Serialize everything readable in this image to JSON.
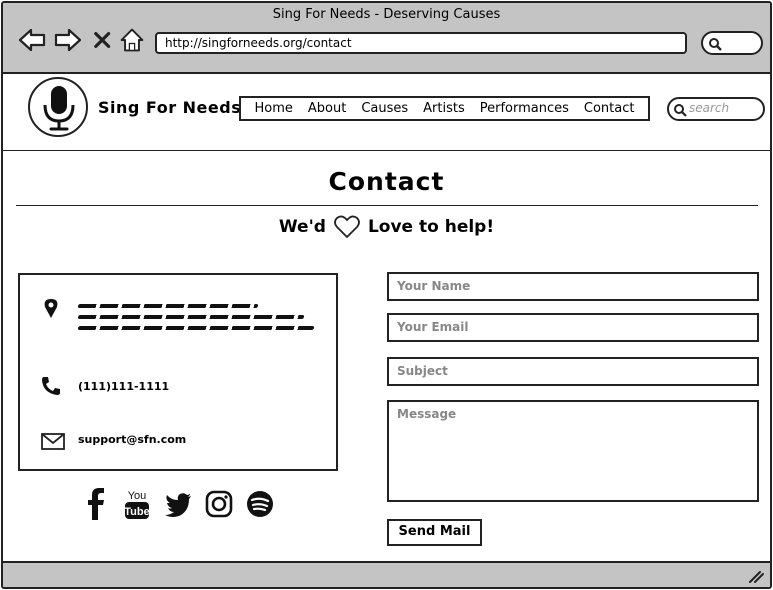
{
  "window": {
    "title": "Sing For Needs - Deserving Causes"
  },
  "browser": {
    "url": "http://singforneeds.org/contact",
    "icons": [
      "back-icon",
      "forward-icon",
      "stop-icon",
      "home-icon",
      "search-icon"
    ]
  },
  "site": {
    "name": "Sing For Needs",
    "logo_icon": "microphone-icon",
    "nav": [
      "Home",
      "About",
      "Causes",
      "Artists",
      "Performances",
      "Contact"
    ],
    "search_placeholder": "search"
  },
  "page": {
    "title": "Contact",
    "tagline_before": "We'd",
    "tagline_icon": "heart-icon",
    "tagline_after": "Love to help!"
  },
  "contact_info": {
    "phone": "(111)111-1111",
    "email": "support@sfn.com"
  },
  "social": [
    "facebook-icon",
    "youtube-icon",
    "twitter-icon",
    "instagram-icon",
    "spotify-icon"
  ],
  "form": {
    "name_placeholder": "Your Name",
    "email_placeholder": "Your Email",
    "subject_placeholder": "Subject",
    "message_placeholder": "Message",
    "submit_label": "Send Mail"
  }
}
